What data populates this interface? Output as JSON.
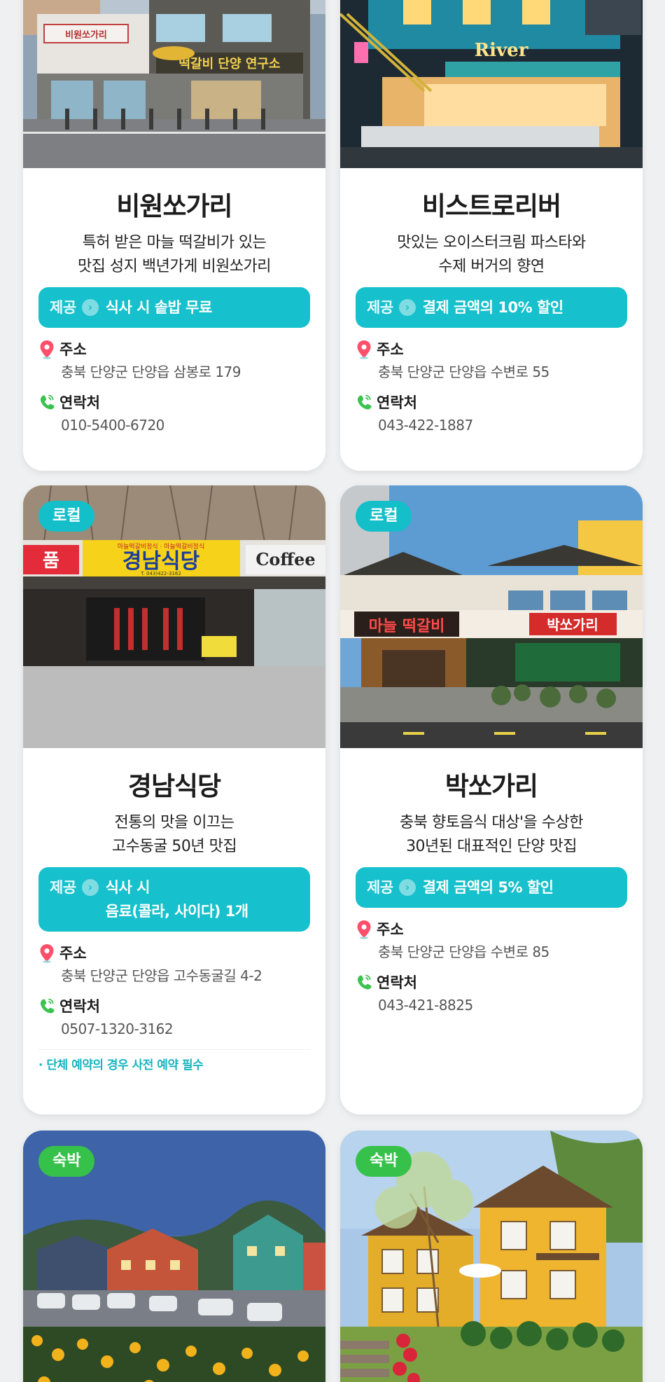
{
  "cards": [
    {
      "name": "비원쏘가리",
      "desc_line1": "특허 받은 마늘 떡갈비가 있는",
      "desc_line2": "맛집 성지 백년가게 비원쏘가리",
      "offer_label": "제공",
      "offer_line1": "식사 시 솥밥 무료",
      "offer_line2": "",
      "address_label": "주소",
      "address": "충북 단양군 단양읍 삼봉로 179",
      "contact_label": "연락처",
      "phone": "010-5400-6720",
      "sign_text": "떡갈비 단양 연구소",
      "sign_text2": "비원쏘가리"
    },
    {
      "name": "비스트로리버",
      "desc_line1": "맛있는 오이스터크림 파스타와",
      "desc_line2": "수제 버거의 향연",
      "offer_label": "제공",
      "offer_line1": "결제 금액의 10% 할인",
      "offer_line2": "",
      "address_label": "주소",
      "address": "충북 단양군 단양읍 수변로 55",
      "contact_label": "연락처",
      "phone": "043-422-1887",
      "sign_text": "River"
    },
    {
      "badge": "로컬",
      "name": "경남식당",
      "desc_line1": "전통의 맛을 이끄는",
      "desc_line2": "고수동굴 50년 맛집",
      "offer_label": "제공",
      "offer_line1": "식사 시",
      "offer_line2": "음료(콜라, 사이다) 1개",
      "address_label": "주소",
      "address": "충북 단양군 단양읍 고수동굴길 4-2",
      "contact_label": "연락처",
      "phone": "0507-1320-3162",
      "note": "· 단체 예약의 경우 사전 예약 필수",
      "sign_text": "경남식당",
      "sign_text2": "Coffee",
      "sign_text3": "품",
      "sign_small": "마늘떡갈비정식 · 마늘떡갈비정식",
      "sign_phone": "T. 043)422-3162"
    },
    {
      "badge": "로컬",
      "name": "박쏘가리",
      "desc_line1": "충북 향토음식 대상'을 수상한",
      "desc_line2": "30년된 대표적인 단양 맛집",
      "offer_label": "제공",
      "offer_line1": "결제 금액의 5% 할인",
      "offer_line2": "",
      "address_label": "주소",
      "address": "충북 단양군 단양읍 수변로 85",
      "contact_label": "연락처",
      "phone": "043-421-8825",
      "sign_text": "박쏘가리",
      "sign_text2": "마늘 떡갈비"
    },
    {
      "badge": "숙박"
    },
    {
      "badge": "숙박"
    }
  ],
  "colors": {
    "accent": "#16c0cc",
    "local_badge": "#15bfc9",
    "stay_badge": "#36c14a",
    "note": "#16b4c0",
    "pin": "#ff4f6b",
    "phone_icon": "#3cc24f"
  }
}
